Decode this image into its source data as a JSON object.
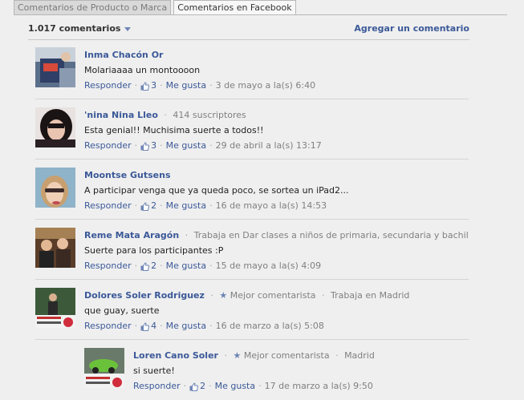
{
  "tabs": [
    "Comentarios de Producto o Marca",
    "Comentarios en Facebook"
  ],
  "header": {
    "count": "1.017 comentarios",
    "add_comment": "Agregar un comentario"
  },
  "comments": [
    {
      "author": "Inma Chacón Or",
      "meta": "",
      "text": "Molariaaaa un montoooon",
      "reply": "Responder",
      "likes": "3",
      "like_label": "Me gusta",
      "date": "3 de mayo a la(s) 6:40"
    },
    {
      "author": "'nina Nina Lleo",
      "meta": "414 suscriptores",
      "text": "Esta genial!! Muchisima suerte a todos!!",
      "reply": "Responder",
      "likes": "3",
      "like_label": "Me gusta",
      "date": "29 de abril a la(s) 13:17"
    },
    {
      "author": "Moontse Gutsens",
      "meta": "",
      "text": "A participar venga que ya queda poco, se sortea un iPad2...",
      "reply": "Responder",
      "likes": "2",
      "like_label": "Me gusta",
      "date": "16 de mayo a la(s) 14:53"
    },
    {
      "author": "Reme Mata Aragón",
      "meta": "Trabaja en Dar clases a niños de primaria, secundaria y bachillerato",
      "text": "Suerte para los participantes :P",
      "reply": "Responder",
      "likes": "2",
      "like_label": "Me gusta",
      "date": "15 de mayo a la(s) 4:09"
    },
    {
      "author": "Dolores Soler Rodriguez",
      "badge": "Mejor comentarista",
      "meta": "Trabaja en Madrid",
      "text": "que guay, suerte",
      "reply": "Responder",
      "likes": "4",
      "like_label": "Me gusta",
      "date": "16 de marzo a la(s) 5:08"
    },
    {
      "author": "Loren Cano Soler",
      "badge": "Mejor comentarista",
      "meta": "Madrid",
      "text": "si suerte!",
      "reply": "Responder",
      "likes": "2",
      "like_label": "Me gusta",
      "date": "17 de marzo a la(s) 9:50"
    }
  ],
  "colors": {
    "link": "#3b5998",
    "meta": "#808080",
    "background": "#efefef"
  }
}
